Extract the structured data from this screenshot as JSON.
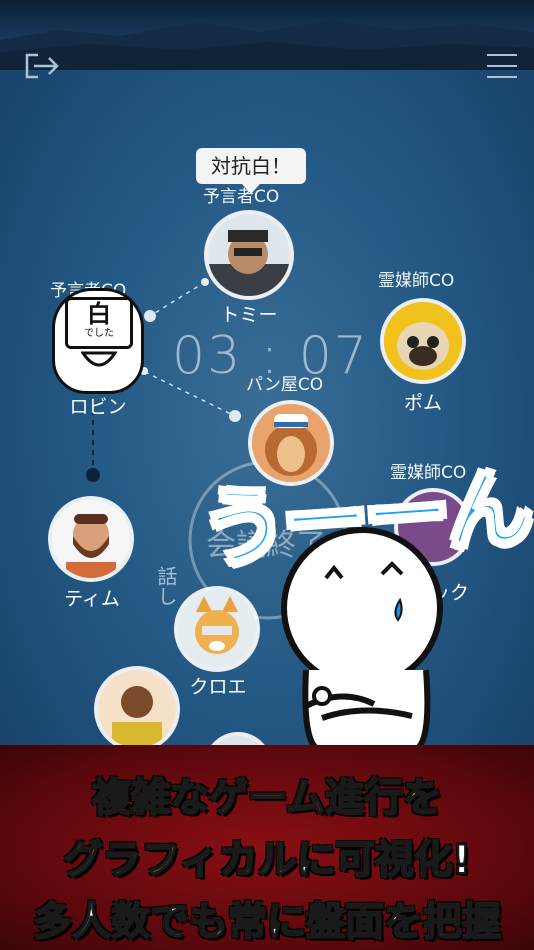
{
  "topbar": {
    "exit_icon": "exit-icon",
    "menu_icon": "hamburger-menu-icon"
  },
  "timer": "03 : 07",
  "speech_bubble": "対抗白！",
  "players": [
    {
      "role": "予言者CO",
      "name": "トミー"
    },
    {
      "role": "予言者CO",
      "name": "ロビン",
      "badge": "白",
      "badge_sub": "でした"
    },
    {
      "role": "霊媒師CO",
      "name": "ポム"
    },
    {
      "role": "パン屋CO",
      "name": ""
    },
    {
      "role": "霊媒師CO",
      "name": "ック"
    },
    {
      "role": "",
      "name": "ティム"
    },
    {
      "role": "",
      "name": "クロエ"
    }
  ],
  "center_text": "会議終了",
  "side_text": "話し",
  "overlay_exclaim": "うーーん",
  "banner": {
    "line1": [
      "複雑な",
      "ゲーム進行",
      "を"
    ],
    "line2": [
      "グラフィカル",
      "に",
      "可視化",
      "!"
    ],
    "line3": [
      "多人数でも常に",
      "盤面",
      "を把握"
    ]
  },
  "colors": {
    "banner_red": "#8a0f14",
    "accent_yellow": "#ffe313",
    "accent_blue": "#1fa0f0"
  }
}
